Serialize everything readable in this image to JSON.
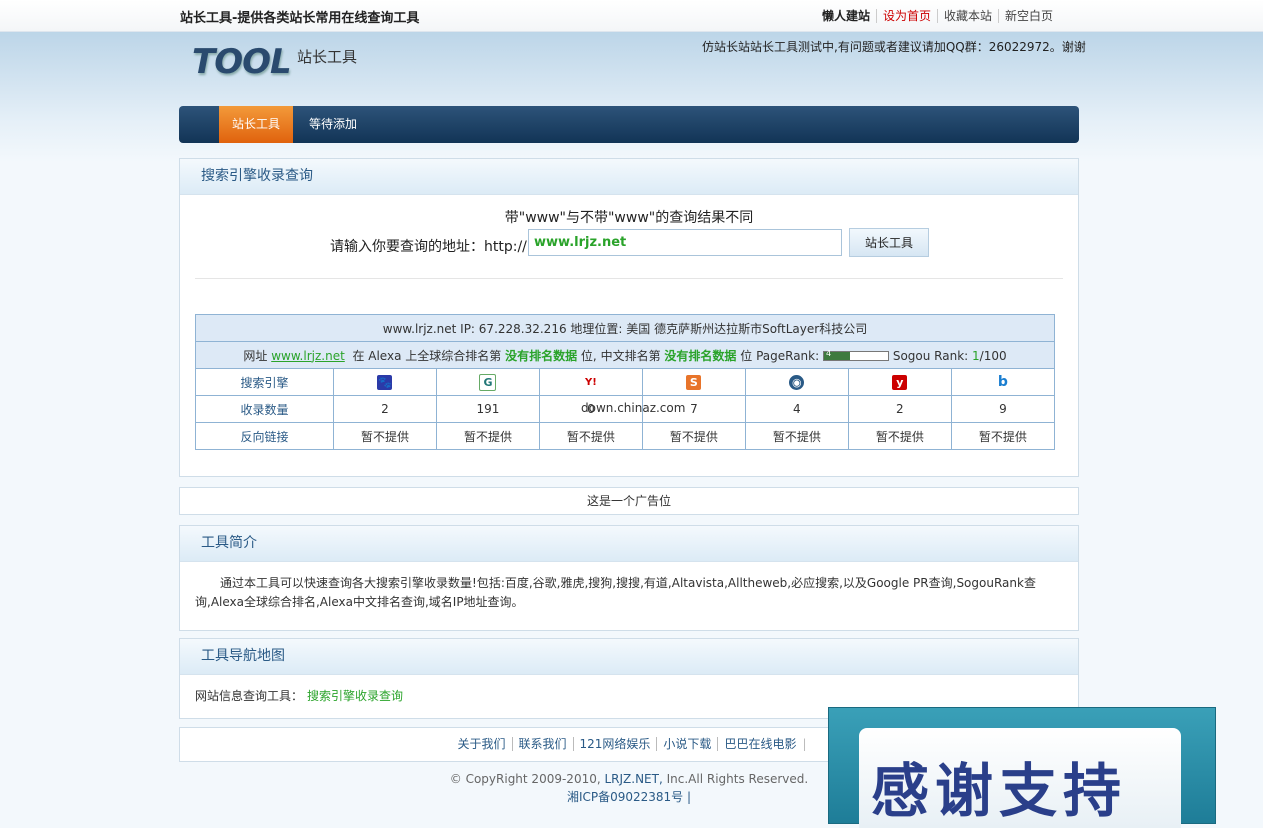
{
  "topbar": {
    "site_title": "站长工具-提供各类站长常用在线查询工具",
    "links": [
      "懒人建站",
      "设为首页",
      "收藏本站",
      "新空白页"
    ]
  },
  "header": {
    "logo_text": "TOOL",
    "logo_cn": "站长工具",
    "notice": "仿站长站站长工具测试中,有问题或者建议请加QQ群：26022972。谢谢"
  },
  "nav": {
    "tabs": [
      "站长工具",
      "等待添加"
    ],
    "active_index": 0
  },
  "search_panel": {
    "title": "搜索引擎收录查询",
    "hint": "带\"www\"与不带\"www\"的查询结果不同",
    "label": "请输入你要查询的地址：http://",
    "input_value": "www.lrjz.net",
    "button": "站长工具"
  },
  "result": {
    "ip_line": "www.lrjz.net IP: 67.228.32.216 地理位置: 美国 德克萨斯州达拉斯市SoftLayer科技公司",
    "rank": {
      "prefix": "网址",
      "site": "www.lrjz.net",
      "alexa_label": "在 Alexa 上全球综合排名第",
      "alexa_value": "没有排名数据",
      "unit1": "位,",
      "cn_label": "中文排名第",
      "cn_value": "没有排名数据",
      "pr_label": "位 PageRank:",
      "pagerank": 4,
      "pr_max": 10,
      "sogou_label": "Sogou Rank:",
      "sogou_value": "1",
      "sogou_total": "/100"
    },
    "row_labels": [
      "搜索引擎",
      "收录数量",
      "反向链接"
    ],
    "engines": [
      {
        "icon": "baidu-icon",
        "glyph": "🐾",
        "count": "2",
        "backlinks": "暂不提供"
      },
      {
        "icon": "google-icon",
        "glyph": "G",
        "count": "191",
        "backlinks": "暂不提供"
      },
      {
        "icon": "yahoo-icon",
        "glyph": "Y!",
        "count": "0",
        "backlinks": "暂不提供"
      },
      {
        "icon": "sogou-icon",
        "glyph": "S",
        "count": "7",
        "backlinks": "暂不提供"
      },
      {
        "icon": "soso-icon",
        "glyph": "◉",
        "count": "4",
        "backlinks": "暂不提供"
      },
      {
        "icon": "youdao-icon",
        "glyph": "y",
        "count": "2",
        "backlinks": "暂不提供"
      },
      {
        "icon": "bing-icon",
        "glyph": "b",
        "count": "9",
        "backlinks": "暂不提供"
      }
    ],
    "watermark": "down.chinaz.com"
  },
  "ad": {
    "text": "这是一个广告位"
  },
  "intro_panel": {
    "title": "工具简介",
    "text": "通过本工具可以快速查询各大搜索引擎收录数量!包括:百度,谷歌,雅虎,搜狗,搜搜,有道,Altavista,Alltheweb,必应搜索,以及Google PR查询,SogouRank查询,Alexa全球综合排名,Alexa中文排名查询,域名IP地址查询。"
  },
  "navmap_panel": {
    "title": "工具导航地图",
    "label": "网站信息查询工具：",
    "link": "搜索引擎收录查询"
  },
  "footer": {
    "links": [
      "关于我们",
      "联系我们",
      "121网络娱乐",
      "小说下载",
      "巴巴在线电影"
    ],
    "copyright_prefix": "© CopyRight 2009-2010,",
    "copyright_site": "LRJZ.NET,",
    "copyright_suffix": "Inc.All Rights Reserved.",
    "icp": "湘ICP备09022381号"
  },
  "thanks_banner": {
    "text": "感谢支持"
  },
  "colors": {
    "nav_bg": "#123456",
    "nav_active": "#e0620d",
    "link_green": "#2aa32a",
    "panel_blue": "#2a5a86"
  }
}
